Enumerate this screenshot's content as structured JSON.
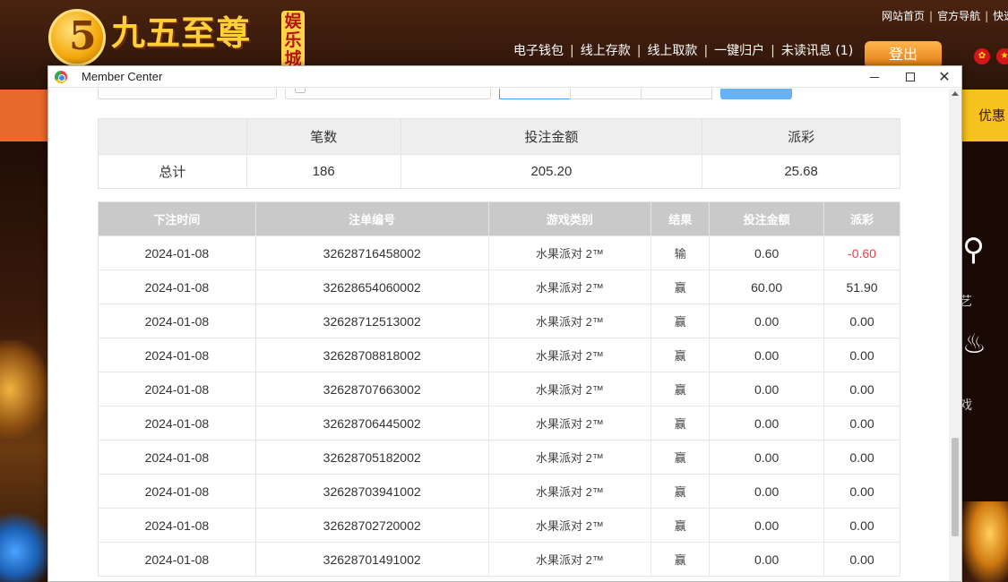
{
  "site": {
    "logo_digit": "5",
    "logo_text": "九五至尊",
    "logo_badge": "娱乐城",
    "top_links": [
      "网站首页",
      "官方导航",
      "快速"
    ],
    "user_links": [
      "电子钱包",
      "线上存款",
      "线上取款",
      "一键归户",
      "未读讯息 (1)"
    ],
    "logout_label": "登出",
    "promo_label": "优惠",
    "side_label_1": "艺",
    "side_label_2": "戏"
  },
  "window": {
    "title": "Member Center"
  },
  "summary": {
    "headers": [
      "",
      "笔数",
      "投注金额",
      "派彩"
    ],
    "row": {
      "label": "总计",
      "count": "186",
      "bet": "205.20",
      "payout": "25.68"
    }
  },
  "detail": {
    "headers": [
      "下注时间",
      "注单编号",
      "游戏类别",
      "结果",
      "投注金额",
      "派彩"
    ],
    "rows": [
      {
        "time": "2024-01-08",
        "id": "32628716458002",
        "type": "水果派对 2™",
        "result": "输",
        "bet": "0.60",
        "payout": "-0.60"
      },
      {
        "time": "2024-01-08",
        "id": "32628654060002",
        "type": "水果派对 2™",
        "result": "赢",
        "bet": "60.00",
        "payout": "51.90"
      },
      {
        "time": "2024-01-08",
        "id": "32628712513002",
        "type": "水果派对 2™",
        "result": "赢",
        "bet": "0.00",
        "payout": "0.00"
      },
      {
        "time": "2024-01-08",
        "id": "32628708818002",
        "type": "水果派对 2™",
        "result": "赢",
        "bet": "0.00",
        "payout": "0.00"
      },
      {
        "time": "2024-01-08",
        "id": "32628707663002",
        "type": "水果派对 2™",
        "result": "赢",
        "bet": "0.00",
        "payout": "0.00"
      },
      {
        "time": "2024-01-08",
        "id": "32628706445002",
        "type": "水果派对 2™",
        "result": "赢",
        "bet": "0.00",
        "payout": "0.00"
      },
      {
        "time": "2024-01-08",
        "id": "32628705182002",
        "type": "水果派对 2™",
        "result": "赢",
        "bet": "0.00",
        "payout": "0.00"
      },
      {
        "time": "2024-01-08",
        "id": "32628703941002",
        "type": "水果派对 2™",
        "result": "赢",
        "bet": "0.00",
        "payout": "0.00"
      },
      {
        "time": "2024-01-08",
        "id": "32628702720002",
        "type": "水果派对 2™",
        "result": "赢",
        "bet": "0.00",
        "payout": "0.00"
      },
      {
        "time": "2024-01-08",
        "id": "32628701491002",
        "type": "水果派对 2™",
        "result": "赢",
        "bet": "0.00",
        "payout": "0.00"
      }
    ]
  },
  "colors": {
    "negative": "#e8404a",
    "header_gray": "#c9c9c9",
    "summary_header": "#eeeeee",
    "accent_orange": "#e9692c",
    "accent_gold": "#f6c21f"
  }
}
